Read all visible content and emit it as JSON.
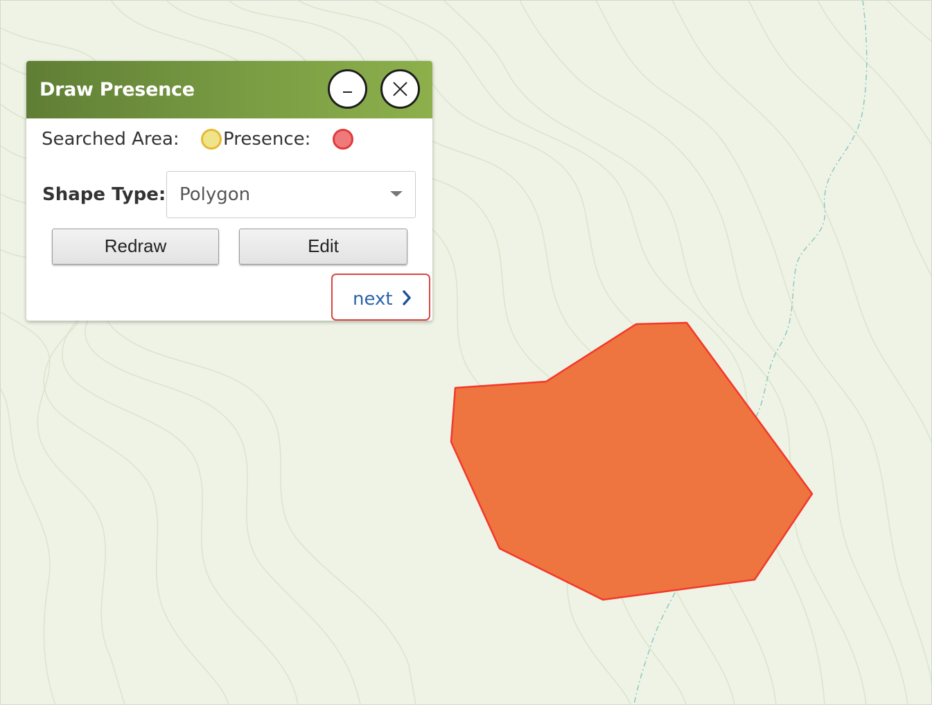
{
  "panel": {
    "title": "Draw Presence",
    "minimize_icon": "minus-icon",
    "close_icon": "close-icon",
    "legend": {
      "searched_label": "Searched Area:",
      "searched_color": "#efe48a",
      "presence_label": "Presence:",
      "presence_color": "#f07a7a"
    },
    "shape_type_label": "Shape Type:",
    "shape_type_value": "Polygon",
    "redraw_label": "Redraw",
    "edit_label": "Edit",
    "next_label": "next",
    "next_icon": "chevron-right-icon"
  },
  "map": {
    "background_color": "#eef3e5",
    "contour_color": "#dbe3cc",
    "stream_color": "#8fc8c4",
    "presence_polygon_fill": "#ee7440",
    "presence_polygon_stroke": "#f2382a"
  }
}
